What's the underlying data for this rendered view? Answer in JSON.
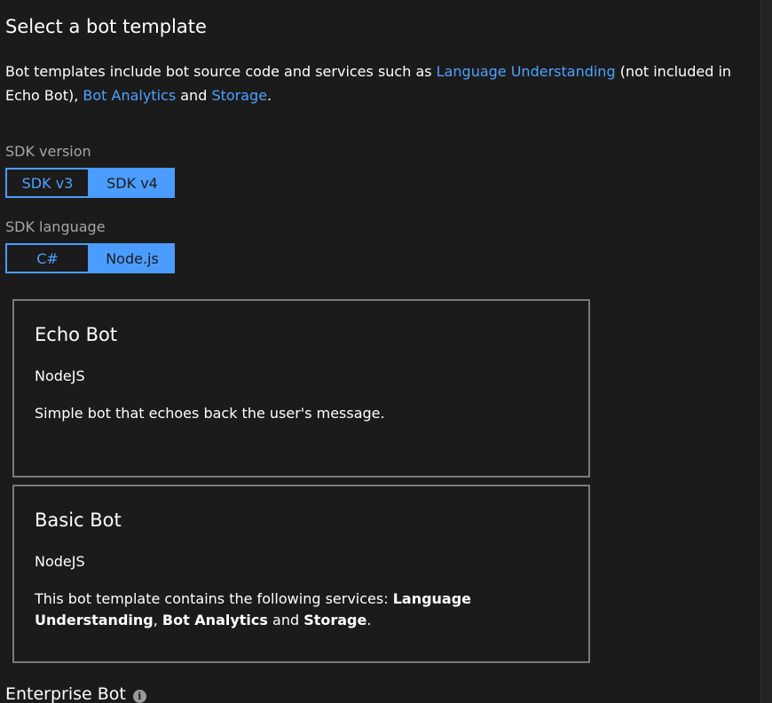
{
  "page": {
    "title": "Select a bot template"
  },
  "intro": {
    "text_start": "Bot templates include bot source code and services such as ",
    "link_language_understanding": "Language Understanding",
    "text_mid": " (not included in Echo Bot), ",
    "link_bot_analytics": "Bot Analytics",
    "text_and": " and ",
    "link_storage": "Storage",
    "text_end": "."
  },
  "sdk_version": {
    "label": "SDK version",
    "options": [
      {
        "label": "SDK v3",
        "selected": false
      },
      {
        "label": "SDK v4",
        "selected": true
      }
    ]
  },
  "sdk_language": {
    "label": "SDK language",
    "options": [
      {
        "label": "C#",
        "selected": false
      },
      {
        "label": "Node.js",
        "selected": true
      }
    ]
  },
  "templates": [
    {
      "title": "Echo Bot",
      "subtitle": "NodeJS",
      "description": "Simple bot that echoes back the user's message."
    },
    {
      "title": "Basic Bot",
      "subtitle": "NodeJS",
      "description_start": "This bot template contains the following services: ",
      "bold_1": "Language Understanding",
      "sep_1": ", ",
      "bold_2": "Bot Analytics",
      "sep_2": " and ",
      "bold_3": "Storage",
      "description_end": "."
    }
  ],
  "enterprise": {
    "label": "Enterprise Bot",
    "icon": "info-icon",
    "icon_glyph": "i"
  },
  "colors": {
    "background": "#1b1b1b",
    "accent": "#4b9cff",
    "link": "#4ea1ff",
    "muted_label": "#a6a6a6",
    "card_border": "#7a7a7a"
  }
}
